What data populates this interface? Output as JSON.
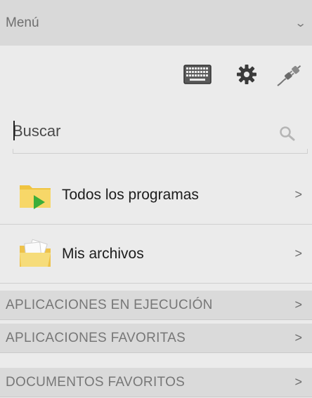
{
  "header": {
    "title": "Menú",
    "collapse_icon": "chevron-down-icon"
  },
  "toolbar": {
    "icons": [
      "keyboard-icon",
      "gear-icon",
      "plug-icon"
    ]
  },
  "search": {
    "placeholder": "Buscar",
    "value": "",
    "icon": "search-icon"
  },
  "items": [
    {
      "label": "Todos los programas",
      "icon": "folder-play-icon",
      "chevron": ">"
    },
    {
      "label": "Mis archivos",
      "icon": "folder-documents-icon",
      "chevron": ">"
    }
  ],
  "sections": [
    {
      "label": "APLICACIONES EN EJECUCIÓN",
      "chevron": ">"
    },
    {
      "label": "APLICACIONES FAVORITAS",
      "chevron": ">"
    },
    {
      "label": "DOCUMENTOS FAVORITOS",
      "chevron": ">"
    }
  ],
  "colors": {
    "header_bg": "#d9d9d9",
    "panel_bg": "#ebebeb",
    "section_bg": "#dadada",
    "folder": "#f5cf5a",
    "play": "#3cae3a"
  }
}
